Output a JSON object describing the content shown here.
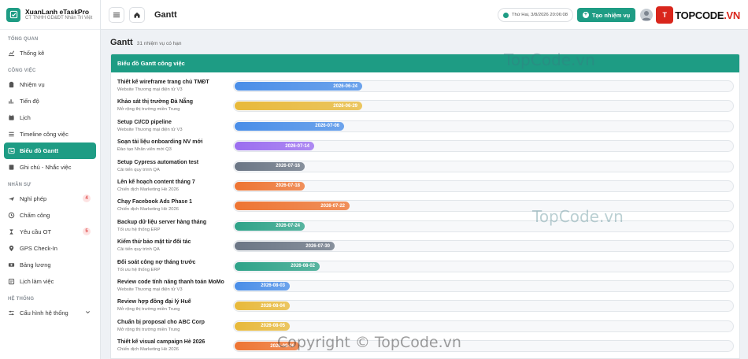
{
  "brand": {
    "name": "XuanLanh eTaskPro",
    "subtitle": "CT TNHH GD&ĐT Nhân Trí Việt"
  },
  "sidebar": {
    "sections": [
      {
        "title": "TỔNG QUAN",
        "items": [
          {
            "label": "Thống kê",
            "icon": "chart-line-icon"
          }
        ]
      },
      {
        "title": "CÔNG VIỆC",
        "items": [
          {
            "label": "Nhiệm vụ",
            "icon": "clipboard-icon"
          },
          {
            "label": "Tiến độ",
            "icon": "bar-chart-icon"
          },
          {
            "label": "Lịch",
            "icon": "calendar-icon"
          },
          {
            "label": "Timeline công việc",
            "icon": "list-icon"
          },
          {
            "label": "Biểu đồ Gantt",
            "icon": "gantt-icon",
            "active": true
          },
          {
            "label": "Ghi chú - Nhắc việc",
            "icon": "note-icon"
          }
        ]
      },
      {
        "title": "NHÂN SỰ",
        "items": [
          {
            "label": "Nghỉ phép",
            "icon": "plane-icon",
            "badge": "4"
          },
          {
            "label": "Chấm công",
            "icon": "clock-icon"
          },
          {
            "label": "Yêu cầu OT",
            "icon": "hourglass-icon",
            "badge": "5"
          },
          {
            "label": "GPS Check-In",
            "icon": "map-pin-icon"
          },
          {
            "label": "Bảng lương",
            "icon": "money-icon"
          },
          {
            "label": "Lịch làm việc",
            "icon": "schedule-icon"
          }
        ]
      },
      {
        "title": "HỆ THỐNG",
        "items": [
          {
            "label": "Cấu hình hệ thống",
            "icon": "sliders-icon",
            "expandable": true
          }
        ]
      }
    ]
  },
  "topbar": {
    "title": "Gantt",
    "datetime": "Thứ Hai, 3/8/2026 20:06:08",
    "create_label": "Tạo nhiệm vụ"
  },
  "logo": {
    "icon_text": "T",
    "text_main": "TOPCODE",
    "text_accent": ".VN"
  },
  "page": {
    "title": "Gantt",
    "subtitle": "31 nhiệm vụ có hạn"
  },
  "card": {
    "title": "Biểu đồ Gantt công việc"
  },
  "colors": {
    "accent": "#1e9c84",
    "blue": "#4a8ee8",
    "yellow": "#e8b93a",
    "purple": "#9b6ef0",
    "slate": "#6b7685",
    "orange": "#ee7533",
    "teal": "#2fa389"
  },
  "tasks": [
    {
      "name": "Thiết kế wireframe trang chủ TMĐT",
      "project": "Website Thương mại điện tử V3",
      "date": "2026-06-24",
      "color": "#4a8ee8",
      "progress": 0.255
    },
    {
      "name": "Khảo sát thị trường Đà Nẵng",
      "project": "Mở rộng thị trường miền Trung",
      "date": "2026-06-29",
      "color": "#e8b93a",
      "progress": 0.255
    },
    {
      "name": "Setup CI/CD pipeline",
      "project": "Website Thương mại điện tử V3",
      "date": "2026-07-06",
      "color": "#4a8ee8",
      "progress": 0.22
    },
    {
      "name": "Soạn tài liệu onboarding NV mới",
      "project": "Đào tạo Nhân viên mới Q3",
      "date": "2026-07-14",
      "color": "#9b6ef0",
      "progress": 0.16
    },
    {
      "name": "Setup Cypress automation test",
      "project": "Cải tiến quy trình QA",
      "date": "2026-07-16",
      "color": "#6b7685",
      "progress": 0.14
    },
    {
      "name": "Lên kế hoạch content tháng 7",
      "project": "Chiến dịch Marketing Hè 2026",
      "date": "2026-07-18",
      "color": "#ee7533",
      "progress": 0.14
    },
    {
      "name": "Chạy Facebook Ads Phase 1",
      "project": "Chiến dịch Marketing Hè 2026",
      "date": "2026-07-22",
      "color": "#ee7533",
      "progress": 0.23
    },
    {
      "name": "Backup dữ liệu server hàng tháng",
      "project": "Tối ưu hệ thống ERP",
      "date": "2026-07-24",
      "color": "#2fa389",
      "progress": 0.14
    },
    {
      "name": "Kiểm thử bảo mật từ đối tác",
      "project": "Cải tiến quy trình QA",
      "date": "2026-07-30",
      "color": "#6b7685",
      "progress": 0.2
    },
    {
      "name": "Đối soát công nợ tháng trước",
      "project": "Tối ưu hệ thống ERP",
      "date": "2026-08-02",
      "color": "#2fa389",
      "progress": 0.17
    },
    {
      "name": "Review code tính năng thanh toán MoMo",
      "project": "Website Thương mại điện tử V3",
      "date": "2026-08-03",
      "color": "#4a8ee8",
      "progress": 0.11
    },
    {
      "name": "Review hợp đồng đại lý Huế",
      "project": "Mở rộng thị trường miền Trung",
      "date": "2026-08-04",
      "color": "#e8b93a",
      "progress": 0.11
    },
    {
      "name": "Chuẩn bị proposal cho ABC Corp",
      "project": "Mở rộng thị trường miền Trung",
      "date": "2026-08-05",
      "color": "#e8b93a",
      "progress": 0.11
    },
    {
      "name": "Thiết kế visual campaign Hè 2026",
      "project": "Chiến dịch Marketing Hè 2026",
      "date": "2026-08-06",
      "color": "#ee7533",
      "progress": 0.13
    }
  ],
  "watermarks": {
    "top": "TopCode.vn",
    "middle": "TopCode.vn",
    "bottom": "Copyright © TopCode.vn"
  }
}
